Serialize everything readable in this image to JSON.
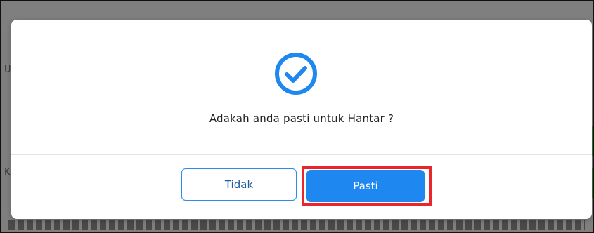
{
  "dialog": {
    "icon": "check-circle-icon",
    "message": "Adakah anda pasti untuk Hantar ?",
    "buttons": {
      "cancel_label": "Tidak",
      "confirm_label": "Pasti"
    }
  },
  "background": {
    "left_fragment_1": "U",
    "left_fragment_2": "K"
  },
  "colors": {
    "accent": "#1e88f0",
    "highlight": "#e8262b",
    "overlay": "#7f7f7f"
  }
}
